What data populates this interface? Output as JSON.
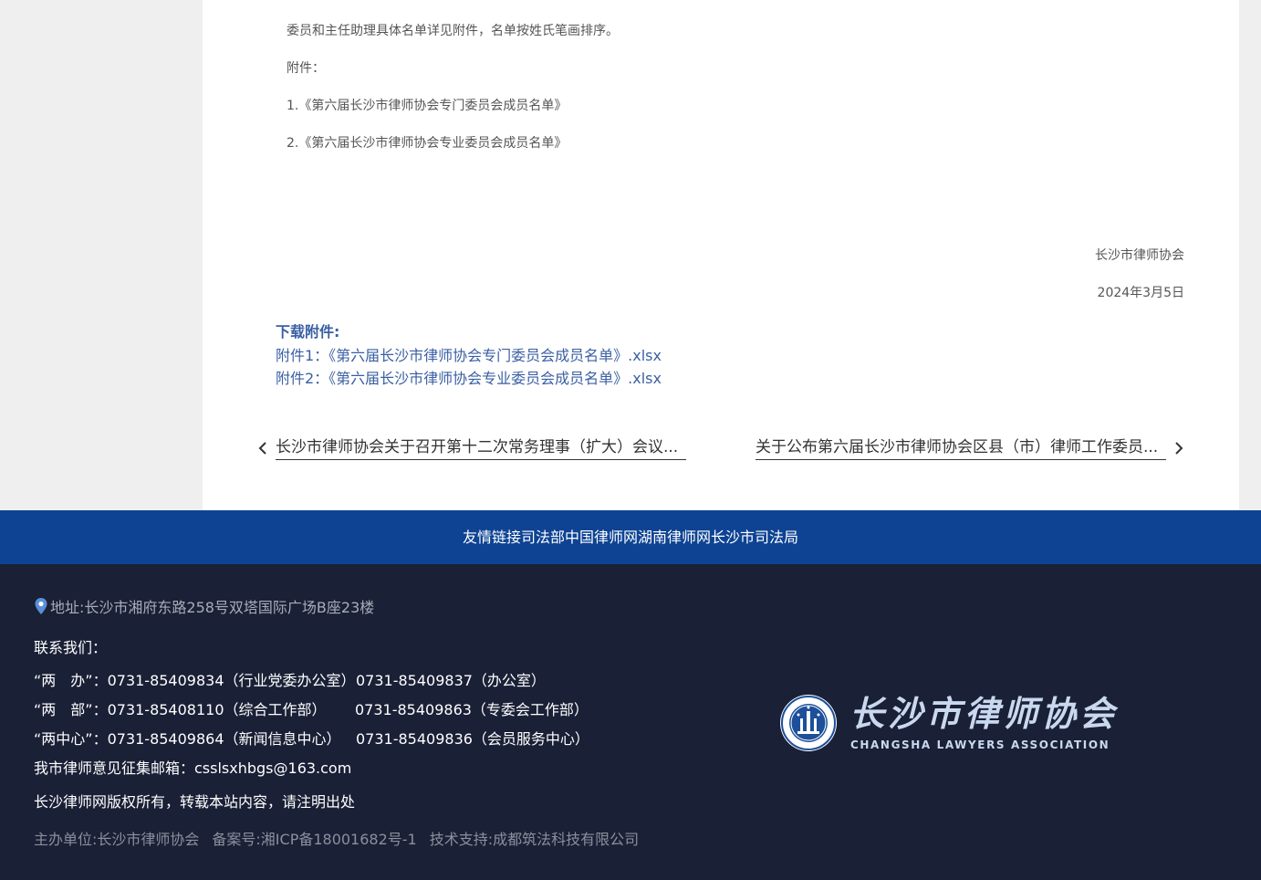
{
  "article": {
    "paragraphs": [
      "委员和主任助理具体名单详见附件，名单按姓氏笔画排序。",
      "附件：",
      "1.《第六届长沙市律师协会专门委员会成员名单》",
      "2.《第六届长沙市律师协会专业委员会成员名单》"
    ],
    "signature": "长沙市律师协会",
    "date": "2024年3月5日"
  },
  "downloads": {
    "title": "下载附件:",
    "files": [
      "附件1：《第六届长沙市律师协会专门委员会成员名单》.xlsx",
      "附件2：《第六届长沙市律师协会专业委员会成员名单》.xlsx"
    ]
  },
  "pager": {
    "prev": "长沙市律师协会关于召开第十二次常务理事（扩大）会议的通知",
    "next": "关于公布第六届长沙市律师协会区县（市）律师工作委员会成员名单的通知"
  },
  "friend_links": {
    "label": "友情链接",
    "items": [
      "司法部",
      "中国律师网",
      "湖南律师网",
      "长沙市司法局"
    ]
  },
  "footer": {
    "address": "地址:长沙市湘府东路258号双塔国际广场B座23楼",
    "contact_title": "联系我们：",
    "contacts": [
      [
        "“两　办”：0731-85409834（行业党委办公室）",
        "0731-85409837（办公室）"
      ],
      [
        "“两　部”：0731-85408110（综合工作部）",
        "0731-85409863（专委会工作部）"
      ],
      [
        "“两中心”：0731-85409864（新闻信息中心）",
        "0731-85409836（会员服务中心）"
      ]
    ],
    "email": "我市律师意见征集邮箱：csslsxhbgs@163.com",
    "copyright": "长沙律师网版权所有，转载本站内容，请注明出处",
    "organizer": "主办单位:长沙市律师协会",
    "icp": "备案号:湘ICP备18001682号-1",
    "tech": "技术支持:成都筑法科技有限公司",
    "logo_text_cn": "长沙市律师协会",
    "logo_text_en": "CHANGSHA LAWYERS ASSOCIATION"
  },
  "colors": {
    "links_bar": "#0e4393",
    "footer_bg": "#1a2036",
    "link_blue": "#3a5fa3"
  },
  "icons": [
    "chevron-left-icon",
    "chevron-right-icon",
    "location-pin-icon"
  ]
}
